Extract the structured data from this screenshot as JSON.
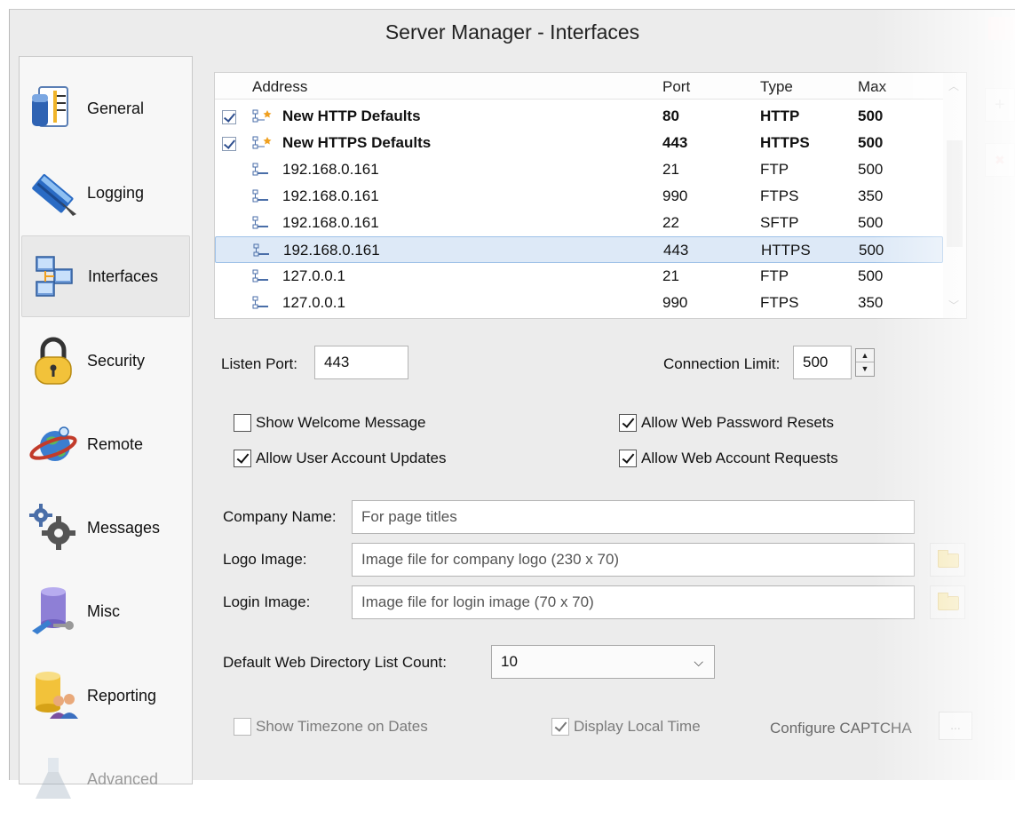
{
  "window": {
    "title": "Server Manager - Interfaces"
  },
  "sidebar": {
    "items": [
      {
        "label": "General",
        "icon": "general-icon",
        "active": false
      },
      {
        "label": "Logging",
        "icon": "logging-icon",
        "active": false
      },
      {
        "label": "Interfaces",
        "icon": "interfaces-icon",
        "active": true
      },
      {
        "label": "Security",
        "icon": "padlock-icon",
        "active": false
      },
      {
        "label": "Remote",
        "icon": "remote-globe-icon",
        "active": false
      },
      {
        "label": "Messages",
        "icon": "gears-icon",
        "active": false
      },
      {
        "label": "Misc",
        "icon": "database-tools-icon",
        "active": false
      },
      {
        "label": "Reporting",
        "icon": "reporting-users-icon",
        "active": false
      },
      {
        "label": "Advanced",
        "icon": "flask-icon",
        "active": false,
        "disabled": true
      }
    ]
  },
  "grid": {
    "headers": {
      "address": "Address",
      "port": "Port",
      "type": "Type",
      "max": "Max"
    },
    "rows": [
      {
        "checked": true,
        "new": true,
        "address": "New HTTP Defaults",
        "port": "80",
        "type": "HTTP",
        "max": "500",
        "bold": true
      },
      {
        "checked": true,
        "new": true,
        "address": "New HTTPS Defaults",
        "port": "443",
        "type": "HTTPS",
        "max": "500",
        "bold": true
      },
      {
        "checked": false,
        "new": false,
        "address": "192.168.0.161",
        "port": "21",
        "type": "FTP",
        "max": "500"
      },
      {
        "checked": false,
        "new": false,
        "address": "192.168.0.161",
        "port": "990",
        "type": "FTPS",
        "max": "350"
      },
      {
        "checked": false,
        "new": false,
        "address": "192.168.0.161",
        "port": "22",
        "type": "SFTP",
        "max": "500"
      },
      {
        "checked": false,
        "new": false,
        "address": "192.168.0.161",
        "port": "443",
        "type": "HTTPS",
        "max": "500",
        "selected": true
      },
      {
        "checked": false,
        "new": false,
        "address": "127.0.0.1",
        "port": "21",
        "type": "FTP",
        "max": "500"
      },
      {
        "checked": false,
        "new": false,
        "address": "127.0.0.1",
        "port": "990",
        "type": "FTPS",
        "max": "350"
      }
    ]
  },
  "form": {
    "listen_port_label": "Listen Port:",
    "listen_port_value": "443",
    "connection_limit_label": "Connection Limit:",
    "connection_limit_value": "500",
    "show_welcome_label": "Show Welcome Message",
    "show_welcome_checked": false,
    "allow_user_updates_label": "Allow User Account Updates",
    "allow_user_updates_checked": true,
    "allow_pw_resets_label": "Allow Web Password Resets",
    "allow_pw_resets_checked": true,
    "allow_account_requests_label": "Allow Web Account Requests",
    "allow_account_requests_checked": true,
    "company_name_label": "Company Name:",
    "company_name_placeholder": "For page titles",
    "logo_image_label": "Logo Image:",
    "logo_image_placeholder": "Image file for company logo (230 x 70)",
    "login_image_label": "Login Image:",
    "login_image_placeholder": "Image file for login image (70 x 70)",
    "dir_list_count_label": "Default Web Directory List Count:",
    "dir_list_count_value": "10",
    "show_timezone_label": "Show Timezone on Dates",
    "show_timezone_checked": false,
    "display_local_time_label": "Display Local Time",
    "display_local_time_checked": true,
    "configure_captcha_label": "Configure CAPTCHA",
    "ellipsis_label": "..."
  },
  "toolbar": {
    "add_glyph": "+",
    "delete_glyph": "✖"
  },
  "colors": {
    "selection": "#dde9f7",
    "selection_border": "#9fc2e8",
    "window_bg": "#ececec"
  }
}
